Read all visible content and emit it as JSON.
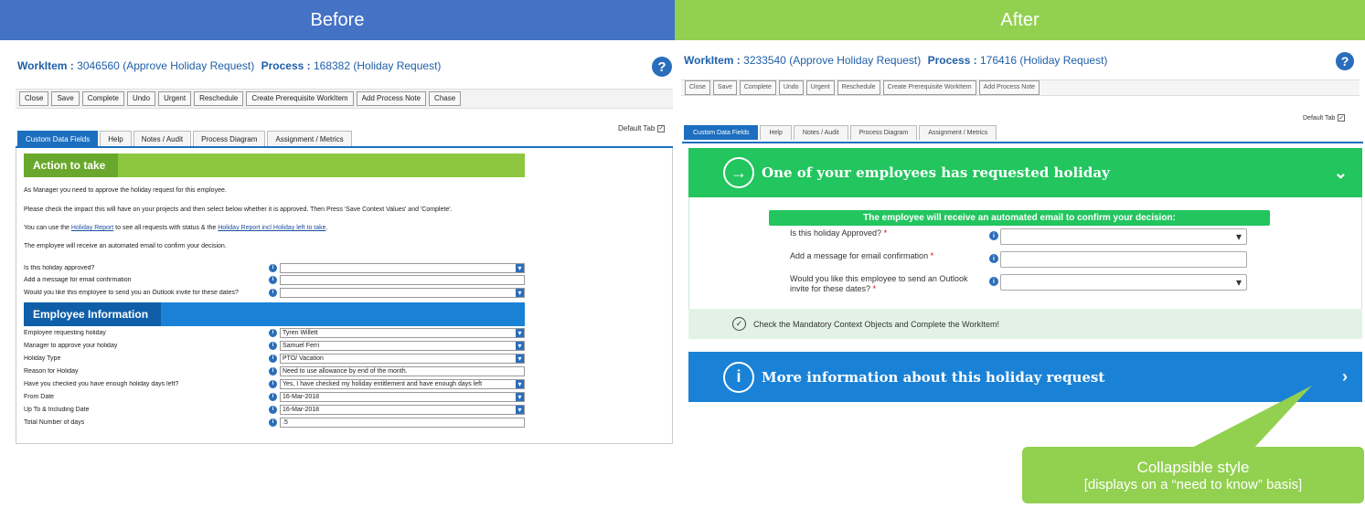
{
  "headers": {
    "before": "Before",
    "after": "After"
  },
  "before": {
    "workitem_label": "WorkItem :",
    "workitem_value": "3046560 (Approve Holiday Request)",
    "process_label": "Process :",
    "process_value": "168382 (Holiday Request)",
    "help": "?",
    "toolbar": [
      "Close",
      "Save",
      "Complete",
      "Undo",
      "Urgent",
      "Reschedule",
      "Create Prerequisite WorkItem",
      "Add Process Note",
      "Chase"
    ],
    "default_tab": "Default Tab",
    "tabs": [
      "Custom Data Fields",
      "Help",
      "Notes / Audit",
      "Process Diagram",
      "Assignment / Metrics"
    ],
    "action_banner": "Action to take",
    "p1": "As Manager you need to approve the holiday request for this employee.",
    "p2": "Please check the impact this will have on your projects and then select below whether it is approved. Then Press 'Save Context Values' and 'Complete'.",
    "p3_pre": "You can use the ",
    "p3_link1": "Holiday Report",
    "p3_mid": " to see all requests with status & the ",
    "p3_link2": "Holiday Report incl Holiday left to take",
    "p3_post": ".",
    "p4": "The employee will receive an automated email to confirm your decision.",
    "q1": "Is this holiday approved?",
    "q2": "Add a message for email confirmation",
    "q3": "Would you like this employee to send you an Outlook invite for these dates?",
    "emp_banner": "Employee Information",
    "emp": [
      {
        "label": "Employee requesting holiday",
        "value": "Tyren Willett"
      },
      {
        "label": "Manager to approve your holiday",
        "value": "Samuel Ferri"
      },
      {
        "label": "Holiday Type",
        "value": "PTO/ Vacation"
      },
      {
        "label": "Reason for Holiday",
        "value": "Need to use allowance by end of the month."
      },
      {
        "label": "Have you checked you have enough holiday days left?",
        "value": "Yes, I have checked my holiday entitlement and have enough days left"
      },
      {
        "label": "From Date",
        "value": "16-Mar-2018"
      },
      {
        "label": "Up To & Including Date",
        "value": "16-Mar-2018"
      },
      {
        "label": "Total Number of days",
        "value": ".5"
      }
    ]
  },
  "after": {
    "workitem_label": "WorkItem :",
    "workitem_value": "3233540 (Approve Holiday Request)",
    "process_label": "Process :",
    "process_value": "176416 (Holiday Request)",
    "help": "?",
    "toolbar": [
      "Close",
      "Save",
      "Complete",
      "Undo",
      "Urgent",
      "Reschedule",
      "Create Prerequisite WorkItem",
      "Add Process Note"
    ],
    "default_tab": "Default Tab",
    "tabs": [
      "Custom Data Fields",
      "Help",
      "Notes / Audit",
      "Process Diagram",
      "Assignment / Metrics"
    ],
    "green_title": "One of your employees has requested holiday",
    "notice": "The employee will receive an automated email to confirm your decision:",
    "q1": "Is this holiday Approved?",
    "q2": "Add a message for email confirmation",
    "q3a": "Would you like this employee to send an Outlook",
    "q3b": "invite for these dates?",
    "req": "*",
    "check_msg": "Check the Mandatory Context Objects and Complete the WorkItem!",
    "blue_title": "More information about this holiday request"
  },
  "callout": {
    "line1": "Collapsible style",
    "line2": "[displays on a “need to know” basis]"
  },
  "colors": {
    "before_header": "#4472c4",
    "after_header": "#92d050",
    "green_section": "#22c55e",
    "blue_section": "#1a82d6"
  }
}
